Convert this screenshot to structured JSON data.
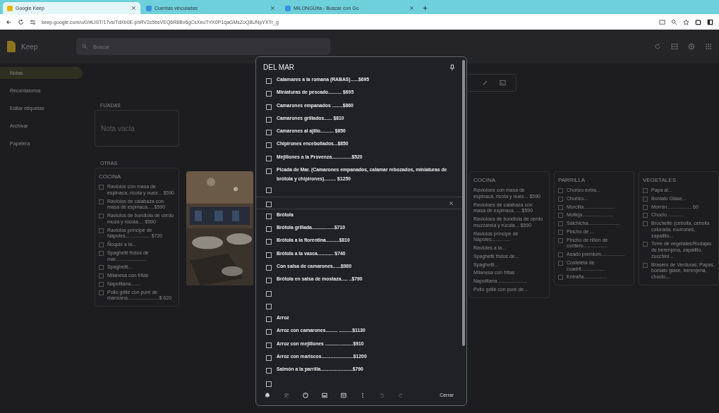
{
  "browser": {
    "tabs": [
      {
        "title": "Google Keep",
        "selected": true
      },
      {
        "title": "Cuentas vinculadas",
        "selected": false
      },
      {
        "title": "MILONGUita - Buscar con Go",
        "selected": false
      }
    ],
    "address": "keep.google.com/u/0/#LIST/17vsiTdXb0E-phRV2c5bsVEQ6R8Bv6gCsXeuTYX0P1qaGMsZoQ8UNpYXTr_g"
  },
  "app": {
    "name": "Keep",
    "search": {
      "placeholder": "Buscar"
    }
  },
  "sidebar": {
    "items": [
      {
        "label": "Notas",
        "selected": true
      },
      {
        "label": "Recordatorios",
        "selected": false
      },
      {
        "label": "Editar etiquetas",
        "selected": false
      },
      {
        "label": "Archivar",
        "selected": false
      },
      {
        "label": "Papelera",
        "selected": false
      }
    ]
  },
  "sections": {
    "pinned_label": "FIJADAS",
    "pinned_note": "Nota vacía",
    "others_label": "OTRAS"
  },
  "notes": [
    {
      "kind": "list",
      "title": "COCINA",
      "items": [
        {
          "text": "Raviolos con masa de espinaca, ricota y nuez... $590",
          "checked": false
        },
        {
          "text": "Raviolos de calabaza con masa de espinaca.....$590",
          "checked": false
        },
        {
          "text": "Raviolos de bondiola de cerdo muza y rúcula.... $590",
          "checked": false
        },
        {
          "text": "Raviolos príncipe de Nápoles.................. $720",
          "checked": false
        },
        {
          "text": "Ñoquis a la...",
          "checked": false
        },
        {
          "text": "Spaghetti frutos de mar.......................",
          "checked": false
        },
        {
          "text": "Spaghetti...",
          "checked": false
        },
        {
          "text": "Milanesa con fritas",
          "checked": false
        },
        {
          "text": "Napolitana.......",
          "checked": false
        },
        {
          "text": "Pollo grillé con puré de manzana.......................$ 620",
          "checked": false
        }
      ]
    },
    {
      "kind": "picture"
    },
    {
      "kind": "list",
      "title": "COCINA",
      "items": [
        {
          "text": "Ravioloes con masa de espinaca, ricota y nuez... $590"
        },
        {
          "text": "Ravioloes de calabaza con masa de espinaca. ....$590"
        },
        {
          "text": "Ravioloes de bondiola de cerdo muzzarela y rúcula... $590"
        },
        {
          "text": "Raviolos príncipe de Nápoles.............."
        },
        {
          "text": "Ravioles a la..."
        },
        {
          "text": "Spaghetti frutos de..."
        },
        {
          "text": "Spaghetti..."
        },
        {
          "text": "Milanesa con fritas"
        },
        {
          "text": "Napolitana......................"
        },
        {
          "text": "Pollo grillé con puré de..."
        }
      ]
    },
    {
      "kind": "list",
      "title": "PARRILLA",
      "items": [
        {
          "text": "Chorizo extra...",
          "checked": false
        },
        {
          "text": "Chorizo...",
          "checked": false
        },
        {
          "text": "Morcilla.......................",
          "checked": false
        },
        {
          "text": "Molleja.......................",
          "checked": false
        },
        {
          "text": "Salchicha.......................",
          "checked": false
        },
        {
          "text": "Pincho de ...",
          "checked": false
        },
        {
          "text": "Pincho de riñón de cordero.................",
          "checked": false
        },
        {
          "text": "Asado premium.................",
          "checked": false
        },
        {
          "text": "Costeleta de cuadril.................",
          "checked": false
        },
        {
          "text": "Entraña.................",
          "checked": false
        }
      ]
    },
    {
      "kind": "list",
      "title": "VEGETALES",
      "items": [
        {
          "text": "Papa al...",
          "checked": false
        },
        {
          "text": "Boniato Glase...",
          "checked": false
        },
        {
          "text": "Morrón.................. 60",
          "checked": false
        },
        {
          "text": "Choclo............",
          "checked": false
        },
        {
          "text": "Brochette (cebolla, cebolla colorada, morrones, zapallito...",
          "checked": false
        },
        {
          "text": "Torre de vegetales/Rodajas de berenjena, zapallito, zucchini...",
          "checked": false
        },
        {
          "text": "Brasero de Verduras; Papas, boniato glase, berenjena, choclo,...",
          "checked": false
        }
      ]
    }
  ],
  "editor": {
    "title": "DEL MAR",
    "items": [
      {
        "text": "Calamares a la romana (RABAS)......$695",
        "checked": false
      },
      {
        "text": "Miniaturas de pescado.......... $695",
        "checked": false
      },
      {
        "text": "Camarones empanados ........$860",
        "checked": false
      },
      {
        "text": "Camarones grillados...... $810",
        "checked": false
      },
      {
        "text": "Camarones al ajillo.......... $850",
        "checked": false
      },
      {
        "text": "Chipirones encebollados...$850",
        "checked": false
      },
      {
        "text": "Mejillones a la Provenza...............$520",
        "checked": false
      },
      {
        "text": "Picada de Mar. (Camarones empanados, calamar rebozados, miniaturas de brótola y chipirones)......... $1250",
        "checked": false
      },
      {
        "checked": false,
        "focused": false
      },
      {
        "checked": false,
        "focused": true
      },
      {
        "text": "Brótola",
        "checked": false
      },
      {
        "text": "Brótola grillada.................$710",
        "checked": false
      },
      {
        "text": "Brótola a la florentina..........$810",
        "checked": false
      },
      {
        "text": "Brótola a la vasca............ $740",
        "checked": false
      },
      {
        "text": "Con salsa de camarones......$980",
        "checked": false
      },
      {
        "text": "Brótola en salsa de mostaza..... ..$790",
        "checked": false
      },
      {
        "checked": false,
        "focused": false
      },
      {
        "checked": false,
        "focused": false
      },
      {
        "text": "Arroz",
        "checked": false
      },
      {
        "text": "Arroz con camarones......... ..........$1130",
        "checked": false
      },
      {
        "text": "Arroz con mejillones .....................$910",
        "checked": false
      },
      {
        "text": "Arroz con mariscos........................$1200",
        "checked": false
      },
      {
        "text": "Salmón a la parrilla........................$790",
        "checked": false
      },
      {
        "checked": false,
        "focused": false
      }
    ],
    "close_button": "Cerrar"
  }
}
